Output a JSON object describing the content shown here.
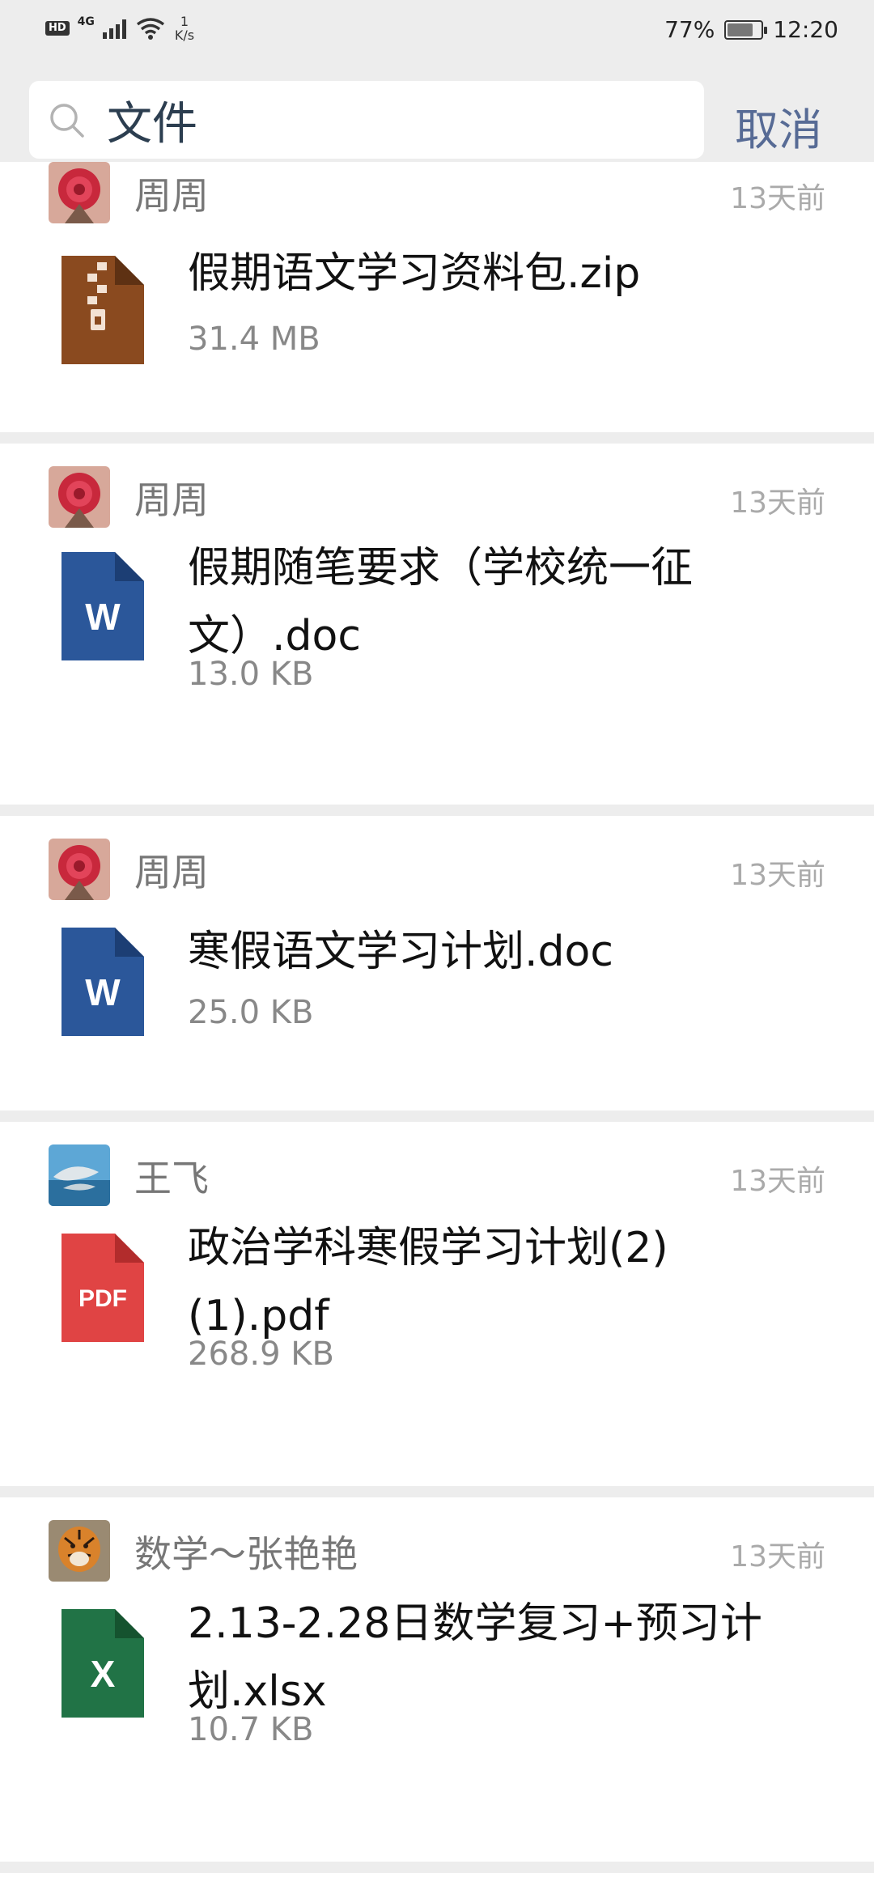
{
  "status_bar": {
    "hd": "HD",
    "network": "4G",
    "speed_value": "1",
    "speed_unit": "K/s",
    "battery": "77%",
    "battery_level": 0.77,
    "time": "12:20"
  },
  "search": {
    "query": "文件",
    "cancel_label": "取消"
  },
  "results": [
    {
      "sender": "周周",
      "time": "13天前",
      "file_name": "假期语文学习资料包.zip",
      "file_size": "31.4 MB",
      "file_type": "zip",
      "avatar": "rose-avatar"
    },
    {
      "sender": "周周",
      "time": "13天前",
      "file_name": "假期随笔要求（学校统一征文）.doc",
      "file_size": "13.0 KB",
      "file_type": "word",
      "icon_letter": "W",
      "avatar": "rose-avatar"
    },
    {
      "sender": "周周",
      "time": "13天前",
      "file_name": "寒假语文学习计划.doc",
      "file_size": "25.0 KB",
      "file_type": "word",
      "icon_letter": "W",
      "avatar": "rose-avatar"
    },
    {
      "sender": "王飞",
      "time": "13天前",
      "file_name": "政治学科寒假学习计划(2)(1).pdf",
      "file_size": "268.9 KB",
      "file_type": "pdf",
      "icon_letter": "PDF",
      "avatar": "dolphin-avatar"
    },
    {
      "sender": "数学～张艳艳",
      "time": "13天前",
      "file_name": "2.13-2.28日数学复习+预习计划.xlsx",
      "file_size": "10.7 KB",
      "file_type": "excel",
      "icon_letter": "X",
      "avatar": "tiger-avatar"
    }
  ],
  "colors": {
    "word": "#2b579a",
    "pdf": "#e04444",
    "excel": "#217346",
    "zip": "#8a4a1f",
    "link": "#576b95"
  }
}
